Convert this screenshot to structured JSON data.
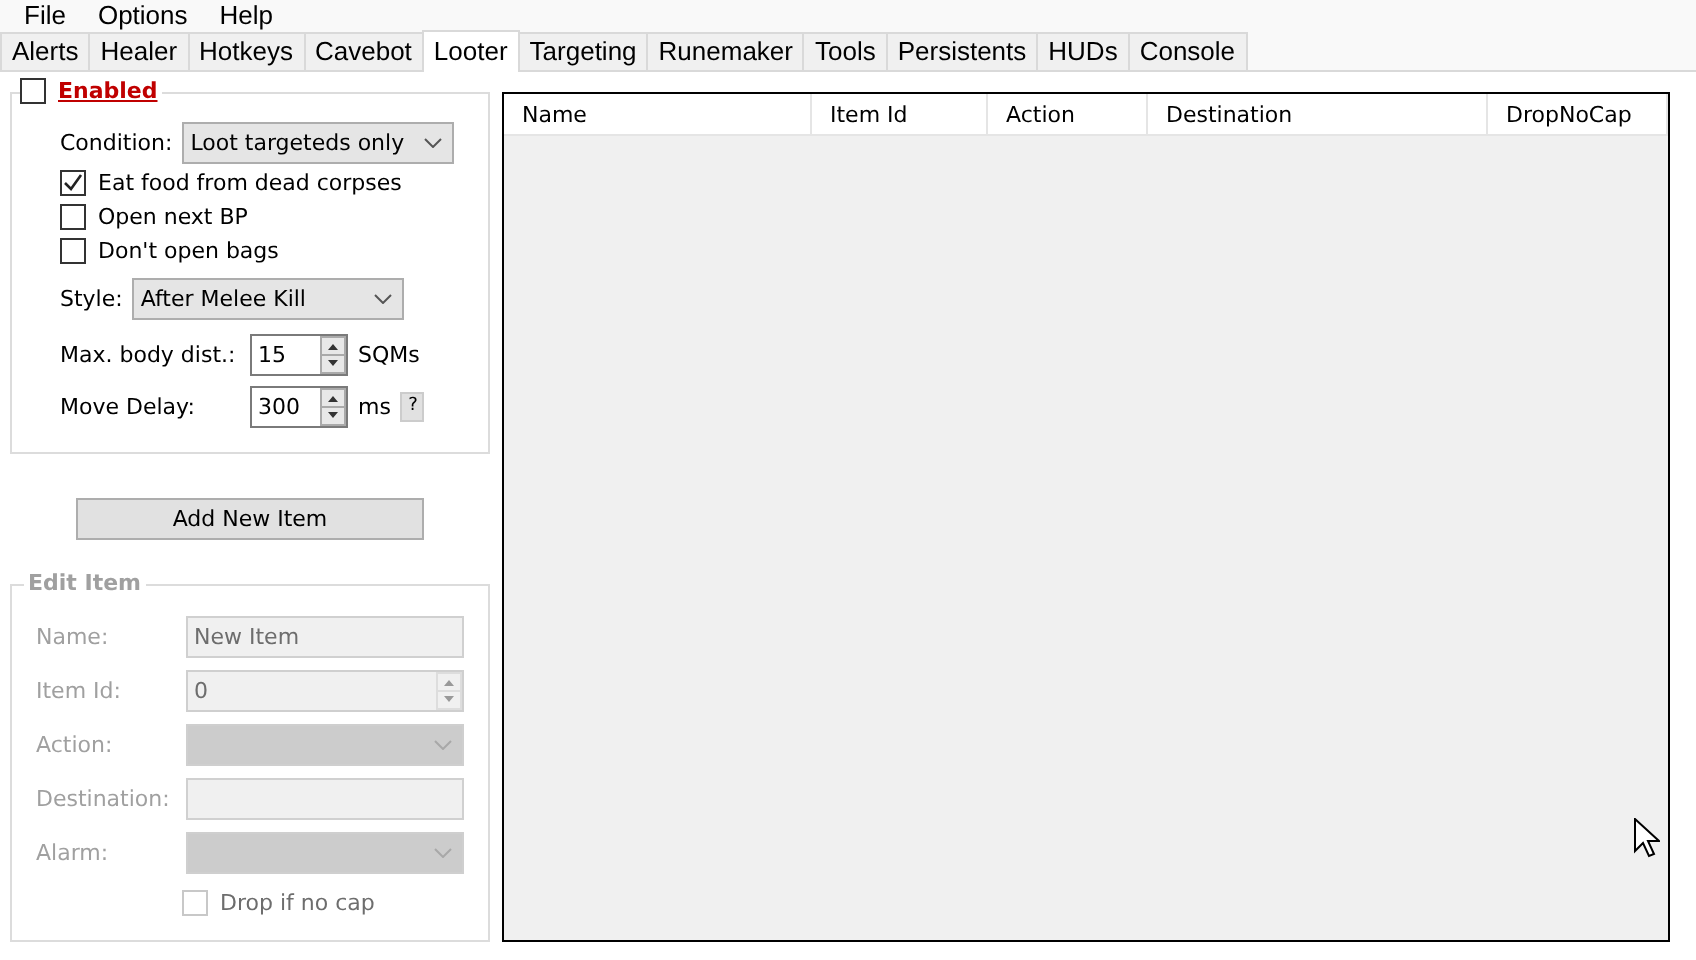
{
  "menu": [
    "File",
    "Options",
    "Help"
  ],
  "tabs": [
    {
      "label": "Alerts",
      "selected": false
    },
    {
      "label": "Healer",
      "selected": false
    },
    {
      "label": "Hotkeys",
      "selected": false
    },
    {
      "label": "Cavebot",
      "selected": false
    },
    {
      "label": "Looter",
      "selected": true
    },
    {
      "label": "Targeting",
      "selected": false
    },
    {
      "label": "Runemaker",
      "selected": false
    },
    {
      "label": "Tools",
      "selected": false
    },
    {
      "label": "Persistents",
      "selected": false
    },
    {
      "label": "HUDs",
      "selected": false
    },
    {
      "label": "Console",
      "selected": false
    }
  ],
  "looter": {
    "enabled": {
      "label": "Enabled",
      "checked": false
    },
    "condition": {
      "label": "Condition:",
      "value": "Loot targeteds only"
    },
    "options": [
      {
        "label": "Eat food from dead corpses",
        "checked": true
      },
      {
        "label": "Open next BP",
        "checked": false
      },
      {
        "label": "Don't open bags",
        "checked": false
      }
    ],
    "style": {
      "label": "Style:",
      "value": "After Melee Kill"
    },
    "body_dist": {
      "label": "Max. body dist.:",
      "value": "15",
      "unit": "SQMs"
    },
    "move_delay": {
      "label": "Move Delay:",
      "value": "300",
      "unit": "ms",
      "help": "?"
    }
  },
  "add_button": "Add New Item",
  "edit_item": {
    "title": "Edit Item",
    "disabled": true,
    "fields": [
      {
        "kind": "text",
        "label": "Name:",
        "value": "New Item"
      },
      {
        "kind": "spin",
        "label": "Item Id:",
        "value": "0"
      },
      {
        "kind": "select",
        "label": "Action:"
      },
      {
        "kind": "text",
        "label": "Destination:"
      },
      {
        "kind": "select",
        "label": "Alarm:"
      }
    ],
    "drop": {
      "label": "Drop if no cap",
      "checked": false
    }
  },
  "table": {
    "columns": [
      "Name",
      "Item Id",
      "Action",
      "Destination",
      "DropNoCap"
    ]
  }
}
